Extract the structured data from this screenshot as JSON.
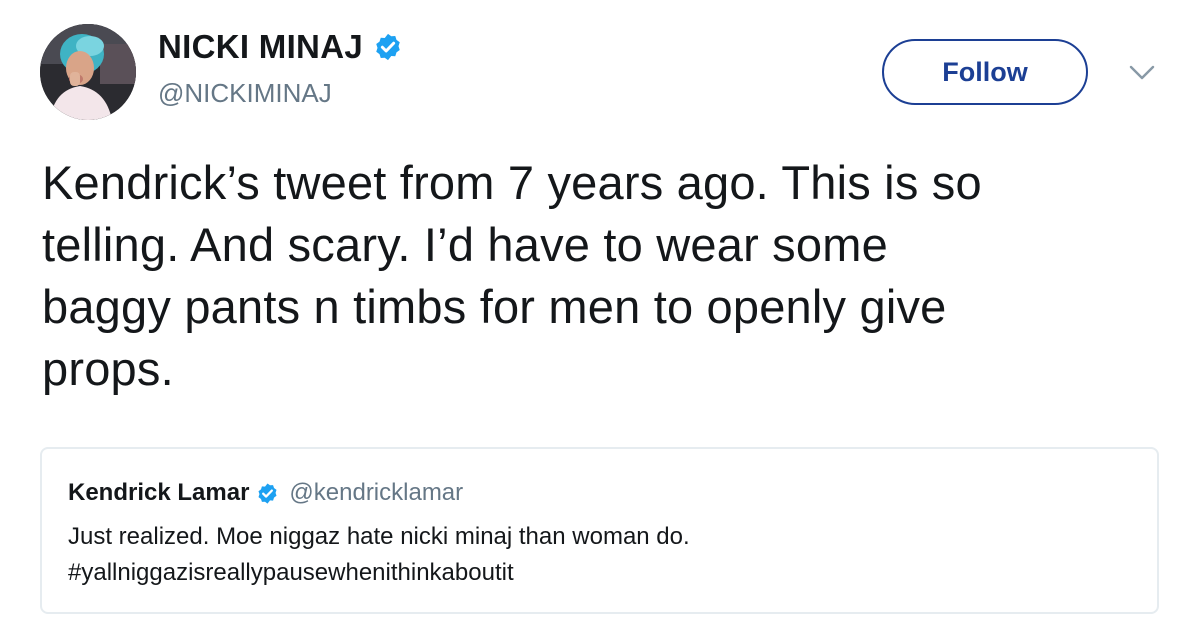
{
  "author": {
    "display_name": "NICKI MINAJ",
    "handle": "@NICKIMINAJ",
    "verified": true
  },
  "follow_button": {
    "label": "Follow"
  },
  "menu": {
    "icon": "chevron-down-icon"
  },
  "tweet": {
    "text_lines": [
      "Kendrick’s tweet from 7 years ago. This is so",
      "telling. And scary. I’d have to wear some",
      "baggy pants n timbs for men to openly give",
      "props."
    ]
  },
  "quoted_tweet": {
    "display_name": "Kendrick Lamar",
    "handle": "@kendricklamar",
    "verified": true,
    "text_lines": [
      "Just realized. Moe niggaz hate nicki minaj than woman do.",
      "#yallniggazisreallypausewhenithinkaboutit"
    ]
  },
  "colors": {
    "follow_accent": "#1c3f94",
    "verified_blue": "#1da1f2",
    "secondary_text": "#657786",
    "border": "#e6ecf0"
  }
}
